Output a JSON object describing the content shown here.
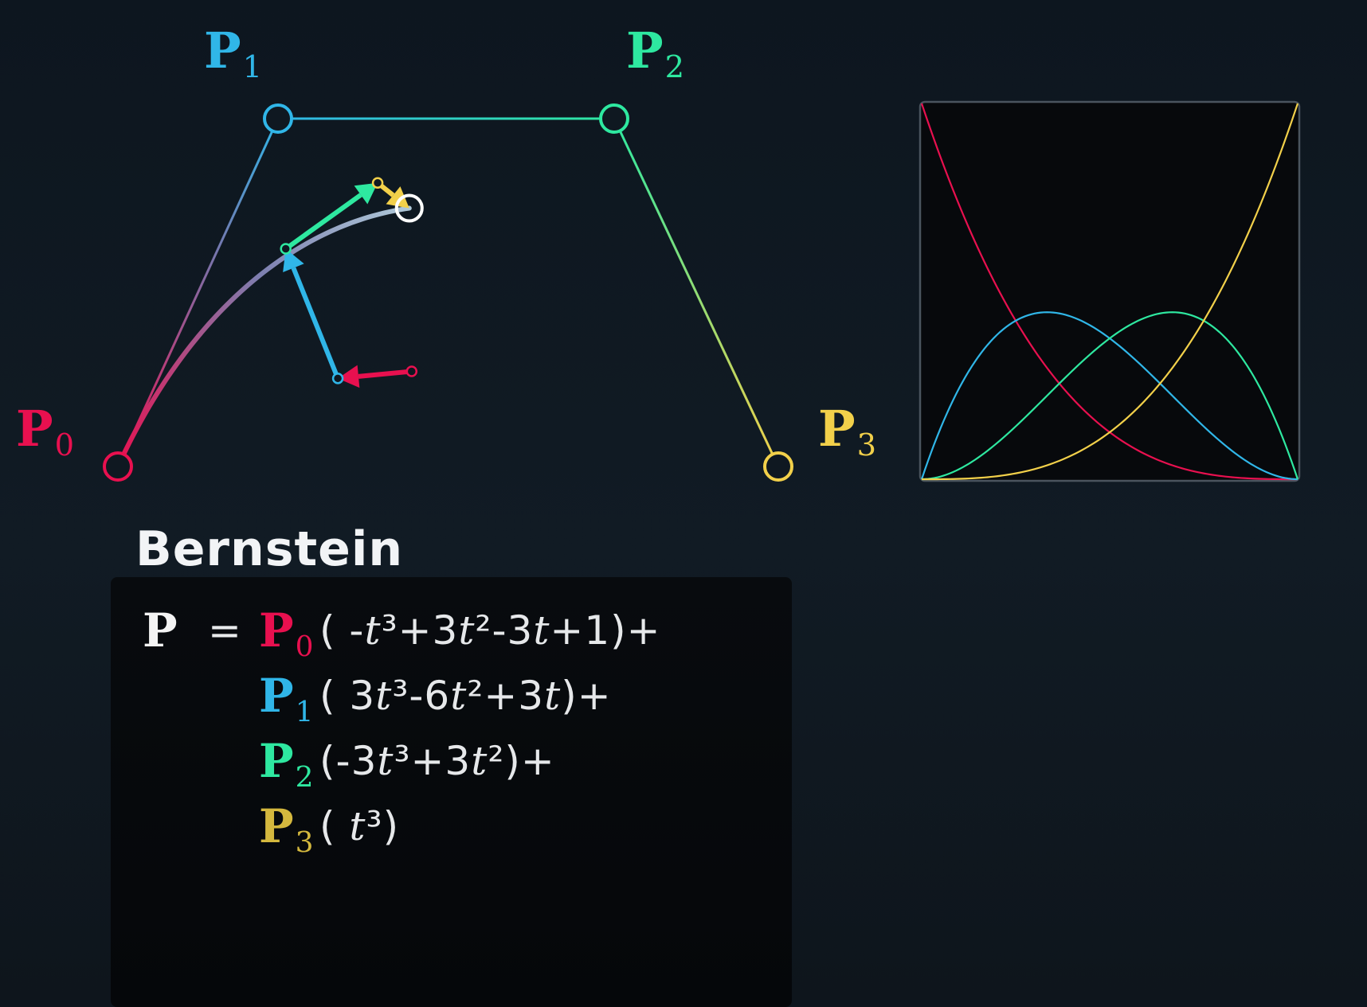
{
  "points": [
    {
      "name": "P",
      "sub": "0",
      "color": "#e8104f"
    },
    {
      "name": "P",
      "sub": "1",
      "color": "#30b6e8"
    },
    {
      "name": "P",
      "sub": "2",
      "color": "#2ee8a0"
    },
    {
      "name": "P",
      "sub": "3",
      "color": "#f2d04a"
    }
  ],
  "section_title": "Bernstein",
  "equation": {
    "lhs": "P",
    "equals": "=",
    "terms": [
      {
        "point": "P",
        "sub": "0",
        "color": "#e8104f",
        "poly": "( -t³+3t²-3t+1)+"
      },
      {
        "point": "P",
        "sub": "1",
        "color": "#30b6e8",
        "poly": "( 3t³-6t²+3t)+"
      },
      {
        "point": "P",
        "sub": "2",
        "color": "#2ee8a0",
        "poly": "(-3t³+3t²)+"
      },
      {
        "point": "P",
        "sub": "3",
        "color": "#d4b83e",
        "poly": "(  t³)"
      }
    ]
  },
  "weights": [
    {
      "label": "-t³+3t²-3t+1",
      "color": "#e8104f"
    },
    {
      "label": "3t³-6t²+3t",
      "color": "#30b6e8"
    },
    {
      "label": "-3t³+3t²",
      "color": "#2ee8a0"
    },
    {
      "label": "t³",
      "color": "#f2d04a"
    }
  ],
  "colors": {
    "background": "#0f1821",
    "curve_point": "#ffffff",
    "plot_background": "#07090c",
    "plot_border": "#4a545e"
  },
  "current_t": 0.45
}
